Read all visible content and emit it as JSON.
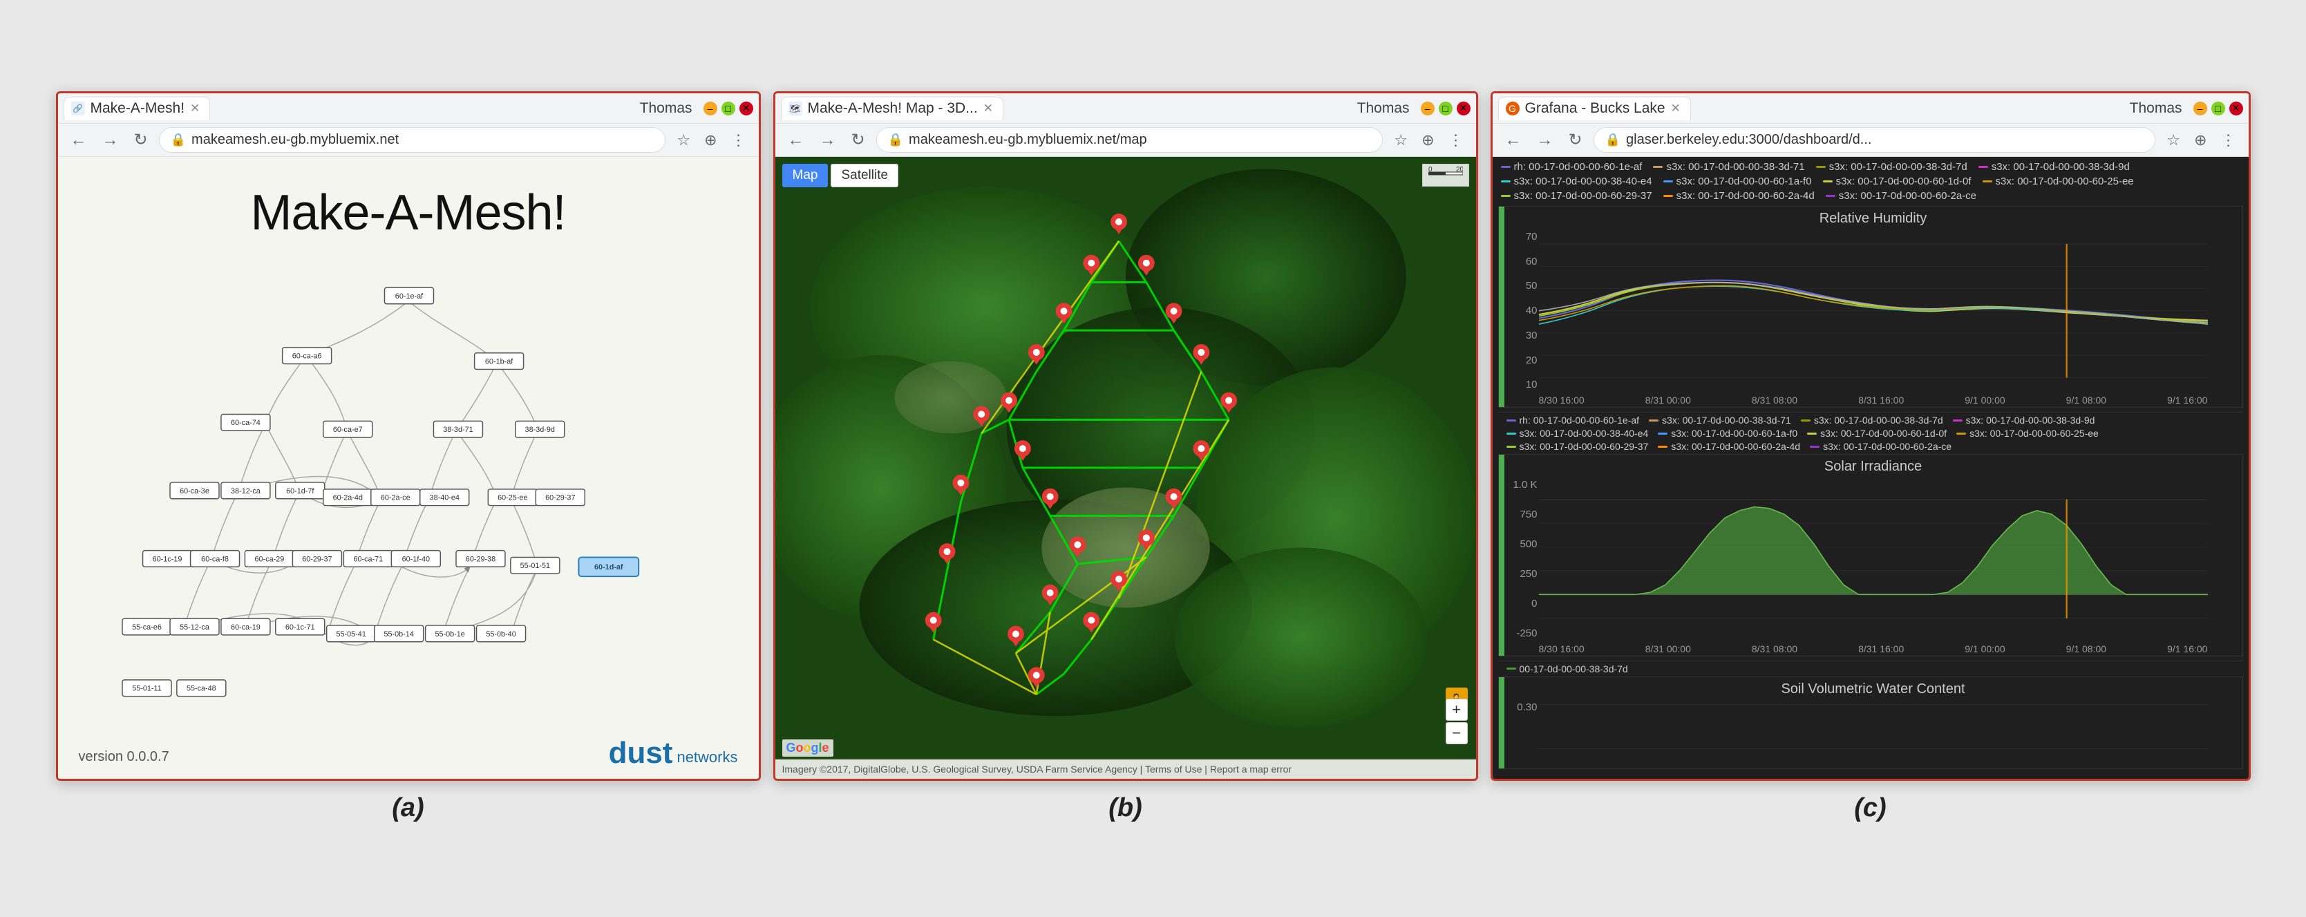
{
  "windows": [
    {
      "id": "window-a",
      "user": "Thomas",
      "tab_label": "Make-A-Mesh!",
      "url": "makeamesh.eu-gb.mybluemix.net",
      "title": "Make-A-Mesh!",
      "version": "version 0.0.0.7",
      "dust_text": "dust",
      "dust_net": "networks",
      "label": "(a)"
    },
    {
      "id": "window-b",
      "user": "Thomas",
      "tab_label": "Make-A-Mesh! Map - 3D...",
      "url": "makeamesh.eu-gb.mybluemix.net/map",
      "map_btn_map": "Map",
      "map_btn_satellite": "Satellite",
      "map_attribution": "Imagery ©2017, DigitalGlobe, U.S. Geological Survey, USDA Farm Service Agency | Terms of Use | Report a map error",
      "label": "(b)"
    },
    {
      "id": "window-c",
      "user": "Thomas",
      "tab_label": "Grafana - Bucks Lake",
      "url": "glaser.berkeley.edu:3000/dashboard/d...",
      "legend_items_top": [
        {
          "color": "#6666cc",
          "text": "rh: 00-17-0d-00-00-60-1e-af"
        },
        {
          "color": "#cc6600",
          "text": "s3x: 00-17-0d-00-00-38-3d-71"
        },
        {
          "color": "#999900",
          "text": "s3x: 00-17-0d-00-00-38-3d-7d"
        },
        {
          "color": "#cc33cc",
          "text": "s3x: 00-17-0d-00-00-38-3d-9d"
        },
        {
          "color": "#33cccc",
          "text": "s3x: 00-17-0d-00-00-38-40-e4"
        },
        {
          "color": "#3399ff",
          "text": "s3x: 00-17-0d-00-00-60-1a-f0"
        },
        {
          "color": "#cccc00",
          "text": "s3x: 00-17-0d-00-00-60-1d-0f"
        },
        {
          "color": "#cc9900",
          "text": "s3x: 00-17-0d-00-00-60-25-ee"
        },
        {
          "color": "#99cc33",
          "text": "s3x: 00-17-0d-00-00-60-29-37"
        },
        {
          "color": "#ff6600",
          "text": "s3x: 00-17-0d-00-00-60-2a-4d"
        },
        {
          "color": "#9933cc",
          "text": "s3x: 00-17-0d-00-00-60-2a-ce"
        }
      ],
      "panels": [
        {
          "id": "humidity",
          "title": "Relative Humidity",
          "yaxis": [
            "70",
            "60",
            "50",
            "40",
            "30",
            "20",
            "10"
          ],
          "xaxis": [
            "8/30 16:00",
            "8/31 00:00",
            "8/31 08:00",
            "8/31 16:00",
            "9/1 00:00",
            "9/1 08:00",
            "9/1 16:00"
          ],
          "legend_items": [
            {
              "color": "#6666cc",
              "text": "rh: 00-17-0d-00-00-60-1e-af"
            },
            {
              "color": "#cc6600",
              "text": "s3x: 00-17-0d-00-00-38-3d-71"
            },
            {
              "color": "#999900",
              "text": "s3x: 00-17-0d-00-00-38-3d-7d"
            },
            {
              "color": "#cc33cc",
              "text": "s3x: 00-17-0d-00-00-38-3d-9d"
            },
            {
              "color": "#33cccc",
              "text": "s3x: 00-17-0d-00-00-38-40-e4"
            },
            {
              "color": "#3399ff",
              "text": "s3x: 00-17-0d-00-00-60-1a-f0"
            },
            {
              "color": "#cccc00",
              "text": "s3x: 00-17-0d-00-00-60-1d-0f"
            },
            {
              "color": "#cc9900",
              "text": "s3x: 00-17-0d-00-00-60-25-ee"
            },
            {
              "color": "#99cc33",
              "text": "s3x: 00-17-0d-00-00-60-29-37"
            },
            {
              "color": "#ff6600",
              "text": "s3x: 00-17-0d-00-00-60-2a-4d"
            },
            {
              "color": "#9933cc",
              "text": "s3x: 00-17-0d-00-00-60-2a-ce"
            }
          ]
        },
        {
          "id": "solar",
          "title": "Solar Irradiance",
          "yaxis": [
            "1.0 K",
            "750",
            "500",
            "250",
            "0",
            "-250"
          ],
          "xaxis": [
            "8/30 16:00",
            "8/31 00:00",
            "8/31 08:00",
            "8/31 16:00",
            "9/1 00:00",
            "9/1 08:00",
            "9/1 16:00"
          ],
          "legend_items": [
            {
              "color": "#4d9900",
              "text": "00-17-0d-00-00-38-3d-7d"
            }
          ]
        },
        {
          "id": "soil",
          "title": "Soil Volumetric Water Content",
          "yaxis": [
            "0.30"
          ],
          "xaxis": []
        }
      ],
      "label": "(c)"
    }
  ]
}
